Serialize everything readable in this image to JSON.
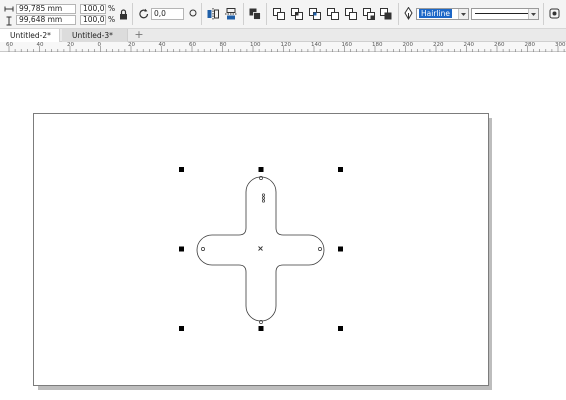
{
  "property_bar": {
    "width_value": "99,785 mm",
    "height_value": "99,648 mm",
    "scale_x": "100,0",
    "scale_y": "100,0",
    "percent_x": "%",
    "percent_y": "%",
    "rotation_value": "0,0",
    "outline_width": "Hairline"
  },
  "tabs": [
    {
      "label": "Untitled-2*"
    },
    {
      "label": "Untitled-3*"
    }
  ],
  "ruler": {
    "labels": [
      "60",
      "40",
      "20",
      "0",
      "20",
      "40",
      "60",
      "80",
      "100",
      "120",
      "140",
      "160",
      "180",
      "200",
      "220",
      "240",
      "260",
      "280",
      "300"
    ]
  },
  "icons": {
    "lock": "lock-icon",
    "rotate": "rotate-icon",
    "mirror": "mirror-icon",
    "combine": "combine-icon",
    "weld": "weld-icon",
    "pen": "pen-icon"
  }
}
